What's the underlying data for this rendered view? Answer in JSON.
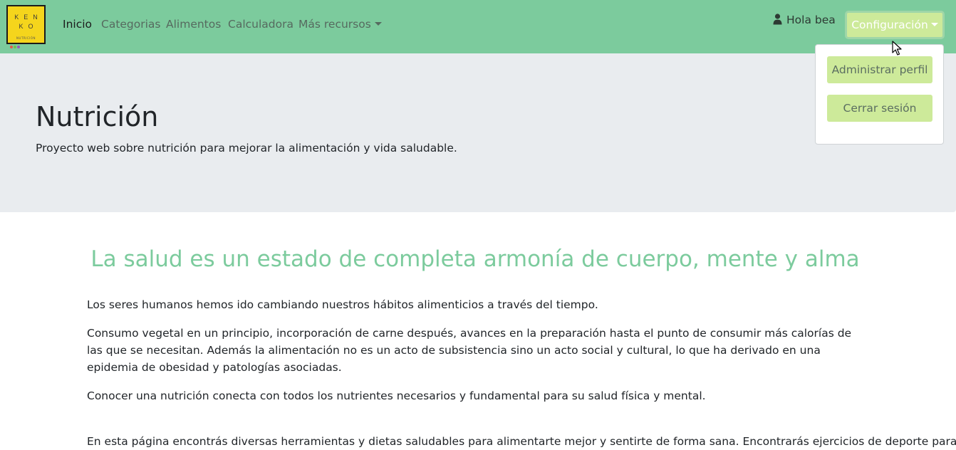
{
  "navbar": {
    "logo": {
      "line1": "KEN",
      "line2": "KO",
      "sub": "NUTRICIÓN"
    },
    "links": [
      {
        "label": "Inicio"
      },
      {
        "label": "Categorias"
      },
      {
        "label": "Alimentos"
      },
      {
        "label": "Calculadora"
      },
      {
        "label": "Más recursos"
      }
    ],
    "user_greeting": "Hola bea",
    "config_label": "Configuración"
  },
  "dropdown": {
    "items": [
      {
        "label": "Administrar perfil"
      },
      {
        "label": "Cerrar sesión"
      }
    ]
  },
  "jumbotron": {
    "title": "Nutrición",
    "subtitle": "Proyecto web sobre nutrición para mejorar la alimentación y vida saludable."
  },
  "main": {
    "heading": "La salud es un estado de completa armonía de cuerpo, mente y alma",
    "paragraphs": [
      "Los seres humanos hemos ido cambiando nuestros hábitos alimenticios a través del tiempo.",
      "Consumo vegetal en un principio, incorporación de carne después, avances en la preparación hasta el punto de consumir más calorías de las que se necesitan. Además la alimentación no es un acto de subsistencia sino un acto social y cultural, lo que ha derivado en una epidemia de obesidad y patologías asociadas.",
      "Conocer una nutrición conecta con todos los nutrientes necesarios y fundamental para su salud física y mental.",
      "En esta página encontrás diversas herramientas y dietas saludables para alimentarte mejor y sentirte de forma sana. Encontrarás ejercicios de deporte para"
    ]
  },
  "colors": {
    "navbar": "#7ccb9d",
    "button": "#cdea9a",
    "heading": "#7ccb9d",
    "jumbotron": "#e9ecef"
  }
}
